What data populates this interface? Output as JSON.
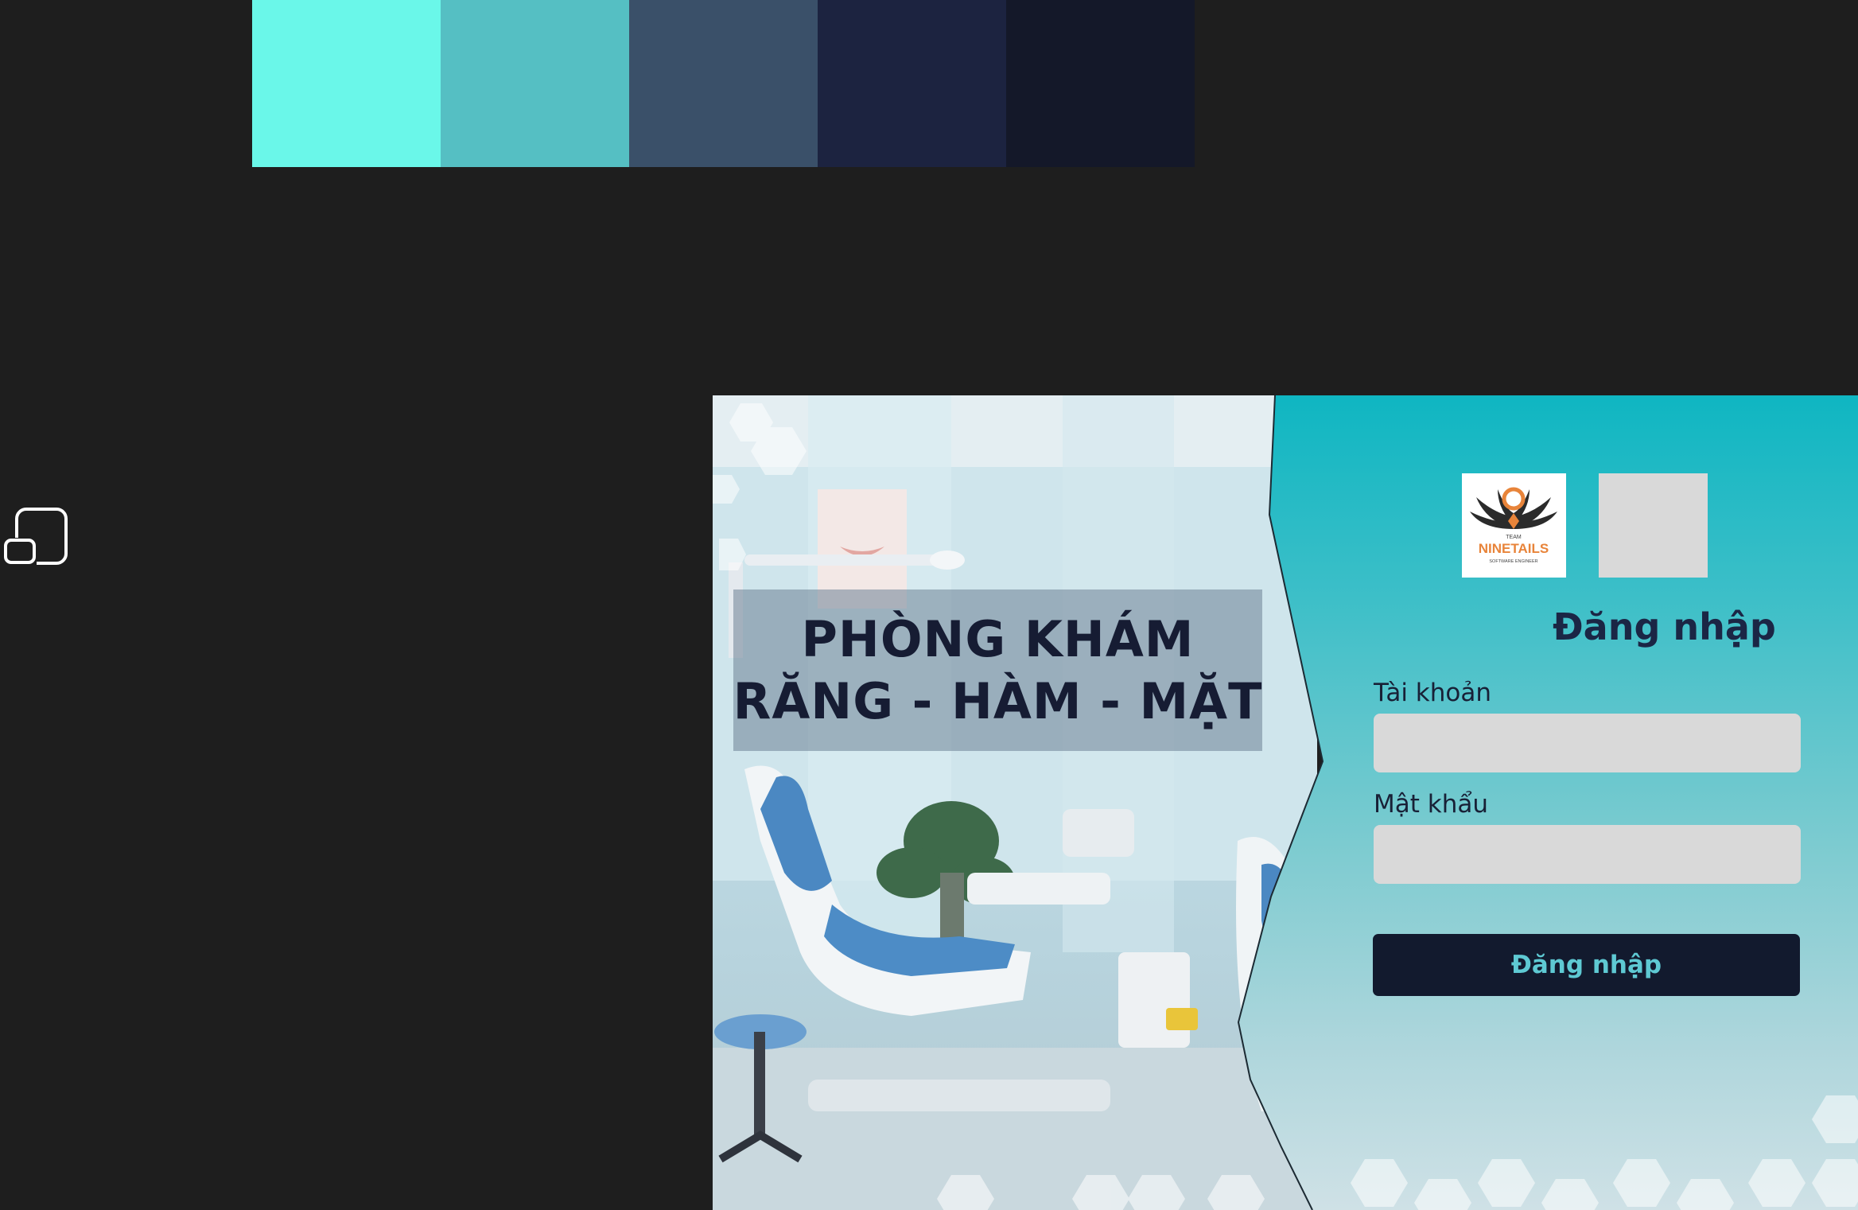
{
  "palette": {
    "colors": [
      "#6af7e9",
      "#55bfc3",
      "#3a5069",
      "#1c2340",
      "#141829"
    ]
  },
  "toolbar": {
    "frame_tool_icon": "resize-frame-icon"
  },
  "login_page": {
    "clinic_title_line1": "PHÒNG KHÁM",
    "clinic_title_line2": "RĂNG - HÀM - MẶT",
    "logo": {
      "text": "NINETAILS",
      "small_top": "TEAM",
      "subtitle": "SOFTWARE ENGINEER"
    },
    "heading": "Đăng nhập",
    "username": {
      "label": "Tài khoản",
      "value": ""
    },
    "password": {
      "label": "Mật khẩu",
      "value": ""
    },
    "submit_label": "Đăng nhập",
    "colors": {
      "button": "#121a2e",
      "button_text": "#5ec9d3",
      "title": "#161c33",
      "heading": "#1b2645"
    }
  }
}
